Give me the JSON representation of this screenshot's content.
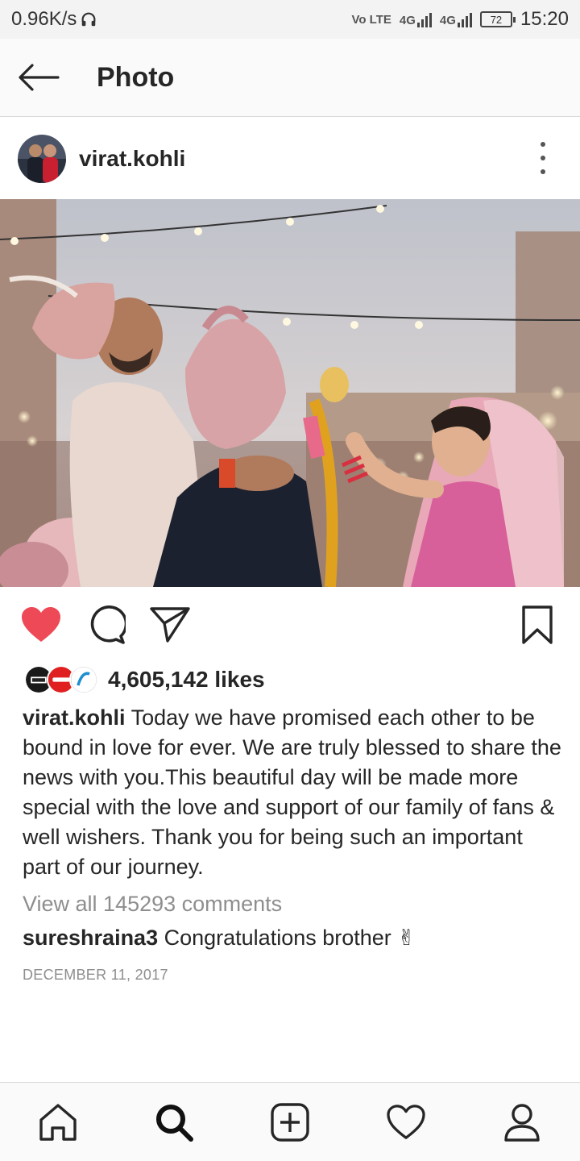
{
  "status_bar": {
    "speed": "0.96K/s",
    "network_label": "Vo LTE",
    "signal_1": "4G",
    "signal_2": "4G",
    "battery": "72",
    "time": "15:20"
  },
  "header": {
    "title": "Photo"
  },
  "post": {
    "username": "virat.kohli",
    "likes": "4,605,142 likes",
    "caption_username": "virat.kohli",
    "caption_text": "Today we have promised each other to be bound in love for ever. We are truly blessed to share the news with you.This beautiful day will be made more special with the love and support of our family of fans & well wishers. Thank you for being such an important part of our journey.",
    "view_comments": "View all 145293 comments",
    "comment_username": "sureshraina3",
    "comment_text": "Congratulations brother ✌",
    "date": "DECEMBER 11, 2017"
  },
  "icons": {
    "like": "heart-filled-icon",
    "comment": "comment-icon",
    "share": "send-icon",
    "save": "bookmark-icon"
  },
  "colors": {
    "like": "#ed4956",
    "text": "#262626",
    "muted": "#8e8e8e"
  }
}
